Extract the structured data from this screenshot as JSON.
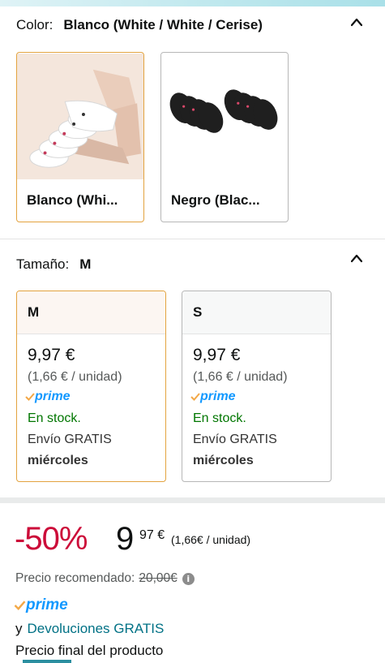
{
  "color": {
    "label": "Color:",
    "value": "Blanco (White / White / Cerise)",
    "options": [
      {
        "name": "Blanco (Whi...",
        "selected": true
      },
      {
        "name": "Negro (Blac...",
        "selected": false
      }
    ]
  },
  "size": {
    "label": "Tamaño:",
    "value": "M",
    "options": [
      {
        "name": "M",
        "price": "9,97 €",
        "unit": "(1,66 € / unidad)",
        "prime": "prime",
        "stock": "En stock.",
        "shipping": "Envío GRATIS",
        "day": "miércoles",
        "selected": true
      },
      {
        "name": "S",
        "price": "9,97 €",
        "unit": "(1,66 € / unidad)",
        "prime": "prime",
        "stock": "En stock.",
        "shipping": "Envío GRATIS",
        "day": "miércoles",
        "selected": false
      }
    ]
  },
  "price": {
    "discount": "-50%",
    "whole": "9",
    "fraction": "97 €",
    "unit": "(1,66€ / unidad)",
    "recommended_label": "Precio recomendado:",
    "recommended_value": "20,00€",
    "prime": "prime",
    "returns_prefix": "y",
    "returns_link": "Devoluciones GRATIS",
    "final_label": "Precio final del producto"
  },
  "colors": {
    "accent_border": "#e3a33f",
    "discount_red": "#cc0c39",
    "stock_green": "#007600",
    "link_teal": "#007185",
    "prime_blue": "#1399ff"
  },
  "icons": [
    "chevron-up-icon",
    "info-icon",
    "prime-check-icon"
  ]
}
